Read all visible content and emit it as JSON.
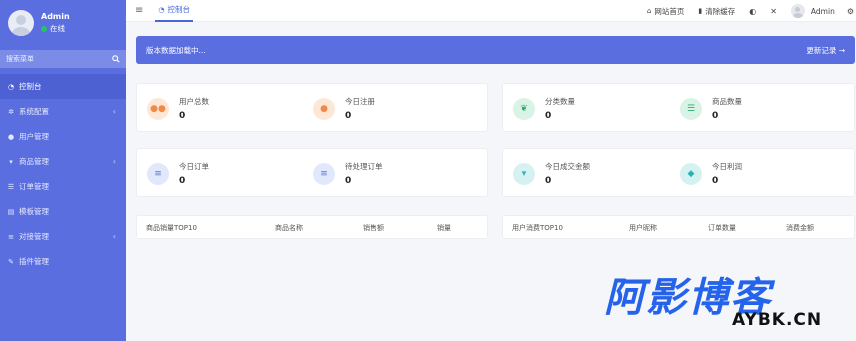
{
  "sidebar": {
    "user_name": "Admin",
    "user_status": "在线",
    "search_placeholder": "搜索菜单",
    "items": [
      {
        "label": "控制台",
        "icon": "dashboard-icon",
        "active": true,
        "has_arrow": false
      },
      {
        "label": "系统配置",
        "icon": "gear-icon",
        "active": false,
        "has_arrow": true
      },
      {
        "label": "用户管理",
        "icon": "user-icon",
        "active": false,
        "has_arrow": false
      },
      {
        "label": "商品管理",
        "icon": "cart-icon",
        "active": false,
        "has_arrow": true
      },
      {
        "label": "订单管理",
        "icon": "list-icon",
        "active": false,
        "has_arrow": false
      },
      {
        "label": "模板管理",
        "icon": "template-icon",
        "active": false,
        "has_arrow": false
      },
      {
        "label": "对接管理",
        "icon": "sliders-icon",
        "active": false,
        "has_arrow": true
      },
      {
        "label": "插件管理",
        "icon": "plugin-icon",
        "active": false,
        "has_arrow": false
      }
    ]
  },
  "topbar": {
    "tab_label": "控制台",
    "links": [
      {
        "label": "网站首页",
        "icon": "home-icon"
      },
      {
        "label": "清除缓存",
        "icon": "trash-icon"
      }
    ],
    "admin_label": "Admin"
  },
  "banner": {
    "text": "版本数据加载中...",
    "link": "更新记录 →"
  },
  "stats_left_top": [
    {
      "label": "用户总数",
      "value": "0",
      "icon": "users-icon",
      "color": "#f08a4b"
    },
    {
      "label": "今日注册",
      "value": "0",
      "icon": "user-icon",
      "color": "#f08a4b"
    }
  ],
  "stats_right_top": [
    {
      "label": "分类数量",
      "value": "0",
      "icon": "leaf-icon",
      "color": "#2eab6e"
    },
    {
      "label": "商品数量",
      "value": "0",
      "icon": "list-icon",
      "color": "#2eab6e"
    }
  ],
  "stats_left_bottom": [
    {
      "label": "今日订单",
      "value": "0",
      "icon": "menu-icon",
      "color": "#5a74d8"
    },
    {
      "label": "待处理订单",
      "value": "0",
      "icon": "menu-icon",
      "color": "#5a74d8"
    }
  ],
  "stats_right_bottom": [
    {
      "label": "今日成交金额",
      "value": "0",
      "icon": "cart-icon",
      "color": "#28b3b3"
    },
    {
      "label": "今日利润",
      "value": "0",
      "icon": "diamond-icon",
      "color": "#28b3b3"
    }
  ],
  "table_left": {
    "headers": [
      "商品销量TOP10",
      "商品名称",
      "销售额",
      "销量"
    ]
  },
  "table_right": {
    "headers": [
      "用户消费TOP10",
      "用户昵称",
      "订单数量",
      "消费金额"
    ]
  },
  "watermark": {
    "cn": "阿影博客",
    "en": "AYBK.CN"
  },
  "colors": {
    "sidebar": "#5a6ee0",
    "accent": "#4a67d6",
    "background": "#f4f6f9"
  }
}
